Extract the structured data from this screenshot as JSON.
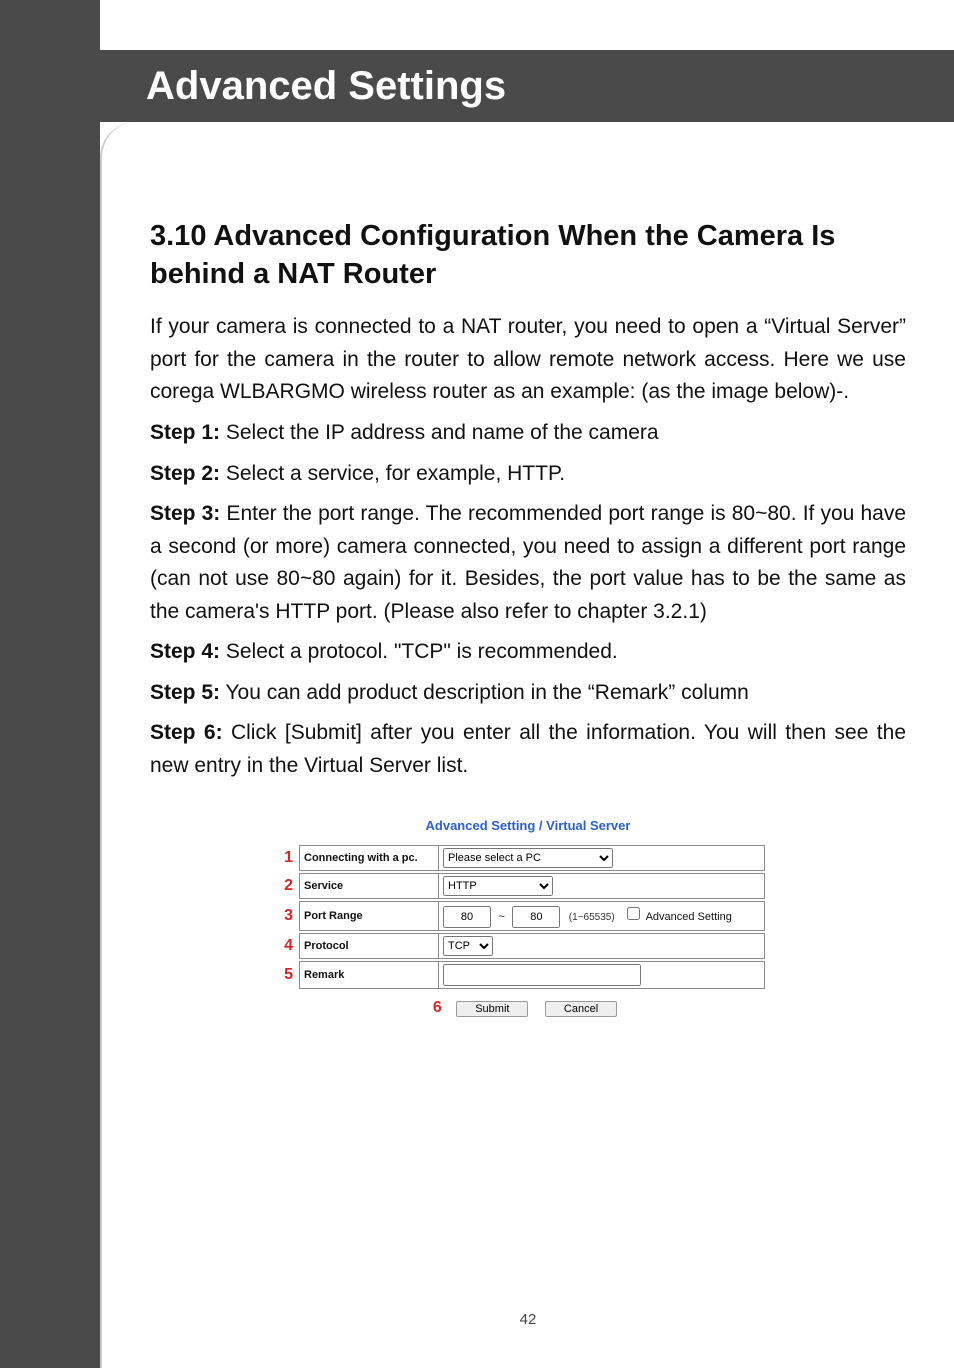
{
  "header": {
    "title": "Advanced Settings"
  },
  "section": {
    "heading": "3.10 Advanced Configuration When  the Camera Is behind a NAT Router",
    "intro": "If your camera is connected to a NAT router, you need to open a “Virtual Server” port for the camera in the router to allow remote network access. Here we use corega WLBARGMO wireless router as an example: (as the image below)-.",
    "steps": [
      {
        "label": "Step 1:",
        "text": " Select the IP address and name of the camera"
      },
      {
        "label": "Step 2:",
        "text": " Select a service, for example, HTTP."
      },
      {
        "label": "Step 3:",
        "text": " Enter the port range. The recommended port range is 80~80. If you have a second (or more) camera connected, you need to assign a different port range (can not use 80~80 again) for it. Besides, the port value has to be the same as the camera's HTTP port. (Please also refer to chapter 3.2.1)"
      },
      {
        "label": "Step 4:",
        "text": " Select a protocol. \"TCP\" is recommended."
      },
      {
        "label": "Step 5:",
        "text": " You can add product description in the “Remark” column"
      },
      {
        "label": "Step 6:",
        "text": " Click [Submit] after you enter all the information. You will then see the new entry in the Virtual Server list."
      }
    ]
  },
  "router": {
    "title": "Advanced Setting / Virtual Server",
    "numbers": {
      "n1": "1",
      "n2": "2",
      "n3": "3",
      "n4": "4",
      "n5": "5",
      "n6": "6"
    },
    "rows": {
      "connecting": "Connecting with a pc.",
      "service": "Service",
      "port_range": "Port Range",
      "protocol": "Protocol",
      "remark": "Remark"
    },
    "values": {
      "pc_select": "Please select a PC",
      "service_select": "HTTP",
      "port_from": "80",
      "port_to": "80",
      "range_help": "(1~65535)",
      "adv_setting": "Advanced Setting",
      "protocol_select": "TCP",
      "remark": ""
    },
    "buttons": {
      "submit": "Submit",
      "cancel": "Cancel"
    }
  },
  "page_number": "42"
}
